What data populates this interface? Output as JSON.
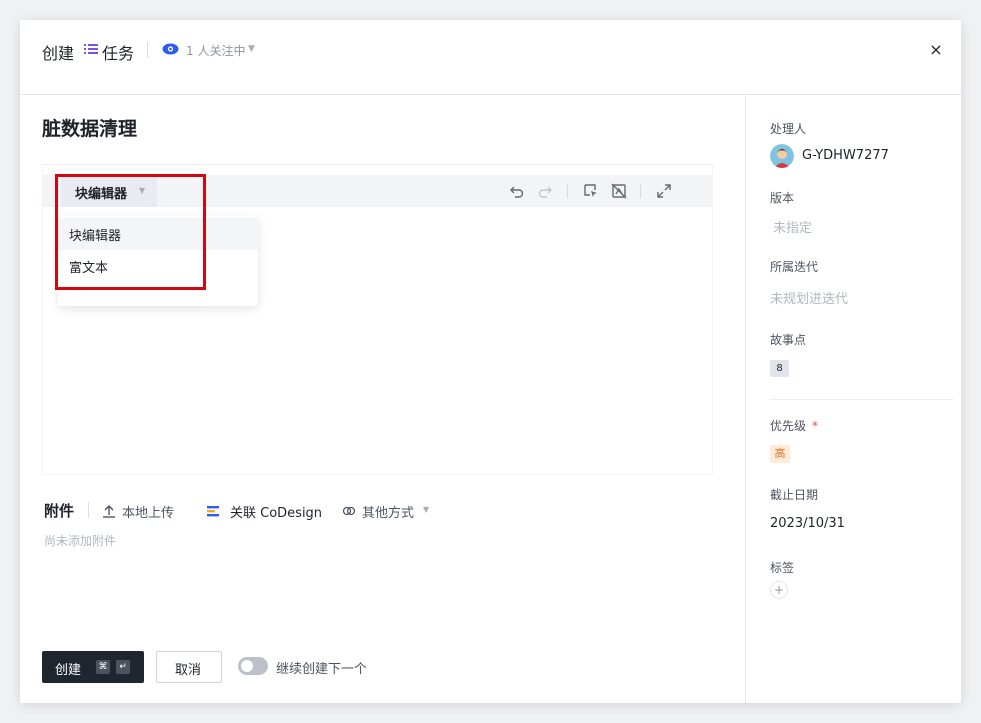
{
  "header": {
    "create_label": "创建",
    "type_label": "任务",
    "watchers_label": "1 人关注中",
    "close_symbol": "×"
  },
  "task": {
    "title": "脏数据清理"
  },
  "editor": {
    "mode_label": "块编辑器",
    "mode_options": [
      "块编辑器",
      "富文本"
    ]
  },
  "attachments": {
    "title": "附件",
    "upload_label": "本地上传",
    "codesign_label": "关联 CoDesign",
    "other_label": "其他方式",
    "empty_text": "尚未添加附件"
  },
  "footer": {
    "create_label": "创建",
    "kbd_cmd": "⌘",
    "kbd_enter": "↵",
    "cancel_label": "取消",
    "continue_label": "继续创建下一个",
    "continue_on": false
  },
  "sidebar": {
    "assignee": {
      "label": "处理人",
      "value": "G-YDHW7277"
    },
    "version": {
      "label": "版本",
      "value": "未指定"
    },
    "iteration": {
      "label": "所属迭代",
      "value": "未规划进迭代"
    },
    "story_points": {
      "label": "故事点",
      "value": "8"
    },
    "priority": {
      "label": "优先级",
      "required_mark": "*",
      "value": "高"
    },
    "due_date": {
      "label": "截止日期",
      "value": "2023/10/31"
    },
    "tags": {
      "label": "标签",
      "add_symbol": "+"
    }
  },
  "colors": {
    "accent": "#2f5cf0",
    "type_icon": "#7b4ee8",
    "highlight": "#d1090e",
    "priority_high": "#e0722a"
  },
  "icons": [
    "list-icon",
    "eye-icon",
    "undo-icon",
    "redo-icon",
    "select-cursor-icon",
    "clear-format-icon",
    "fullscreen-icon",
    "upload-icon",
    "codesign-icon",
    "link-icon"
  ]
}
